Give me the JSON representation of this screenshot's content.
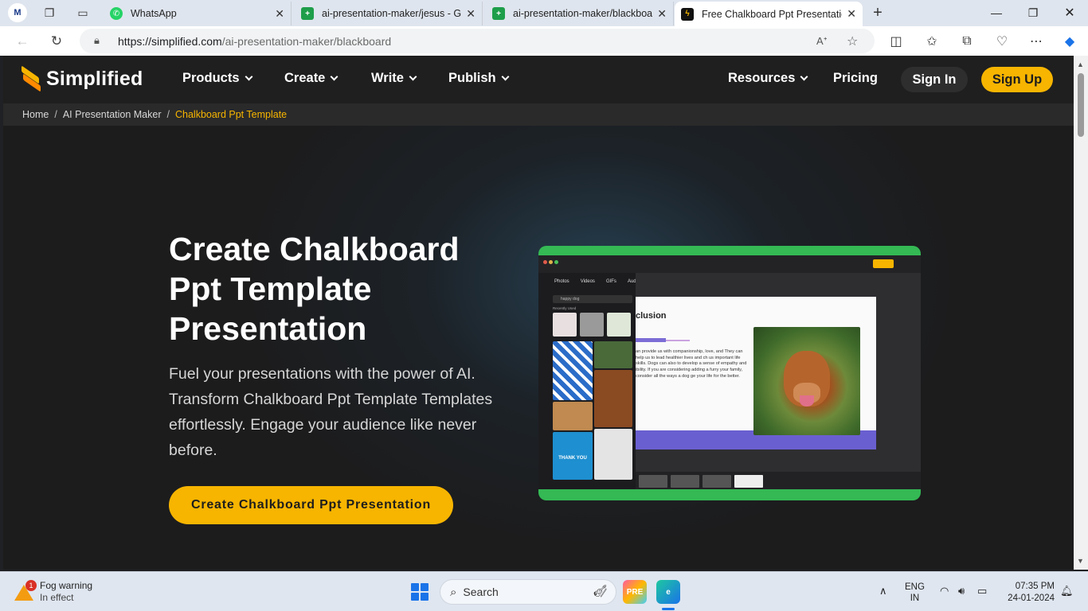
{
  "browser": {
    "tabs": [
      {
        "title": "WhatsApp",
        "icon": "whatsapp-icon",
        "active": false
      },
      {
        "title": "ai-presentation-maker/jesus - Go",
        "icon": "sheets-icon",
        "active": false
      },
      {
        "title": "ai-presentation-maker/blackboar",
        "icon": "sheets-icon",
        "active": false
      },
      {
        "title": "Free Chalkboard Ppt Presentation",
        "icon": "simplified-icon",
        "active": true
      }
    ],
    "profile_label": "M",
    "url_host": "https://simplified.com",
    "url_path": "/ai-presentation-maker/blackboard"
  },
  "site": {
    "logo_text": "Simplified",
    "nav": {
      "products": "Products",
      "create": "Create",
      "write": "Write",
      "publish": "Publish",
      "resources": "Resources",
      "pricing": "Pricing",
      "sign_in": "Sign In",
      "sign_up": "Sign Up"
    },
    "breadcrumb": {
      "home": "Home",
      "section": "AI Presentation Maker",
      "current": "Chalkboard Ppt Template"
    },
    "hero": {
      "title": "Create Chalkboard Ppt Template Presentation",
      "subtitle": "Fuel your presentations with the power of AI. Transform Chalkboard Ppt Template Templates effortlessly. Engage your audience like never before.",
      "cta": "Create Chalkboard Ppt Presentation"
    },
    "preview": {
      "tabs": [
        "Photos",
        "Videos",
        "GIFs",
        "Audio"
      ],
      "search_value": "happy dog",
      "recently_used": "Recently Used",
      "slide_title": "clusion",
      "slide_text": "an provide us with companionship, love, and They can help us to lead healthier lives and ch us important life skills. Dogs can also to develop a sense of empathy and ibility. If you are considering adding a furry your family, consider all the ways a dog ge your life for the better.",
      "thank_you": "THANK YOU"
    }
  },
  "taskbar": {
    "weather_title": "Fog warning",
    "weather_sub": "In effect",
    "weather_badge": "1",
    "search_label": "Search",
    "lang_top": "ENG",
    "lang_bottom": "IN",
    "time": "07:35 PM",
    "date": "24-01-2024"
  },
  "colors": {
    "accent": "#f7b500",
    "page_bg": "#1c1c1d",
    "preview_frame": "#34b954"
  }
}
